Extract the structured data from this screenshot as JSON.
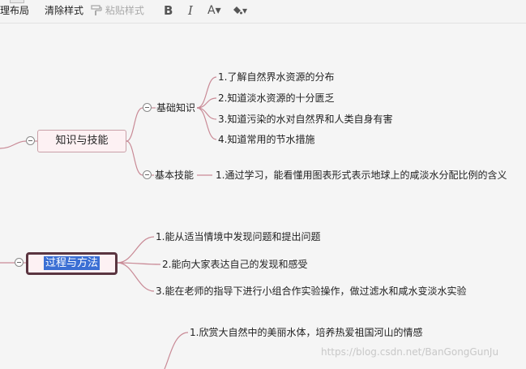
{
  "toolbar": {
    "layout_label": "理布局",
    "clear_style_label": "清除样式",
    "paste_style_label": "粘贴样式",
    "bold_label": "B",
    "italic_label": "I",
    "font_color_label": "A▾",
    "fill_color_label": "▾"
  },
  "mindmap": {
    "knowledge": {
      "title": "知识与技能",
      "basic_knowledge": {
        "label": "基础知识",
        "items": [
          "1.了解自然界水资源的分布",
          "2.知道淡水资源的十分匮乏",
          "3.知道污染的水对自然界和人类自身有害",
          "4.知道常用的节水措施"
        ]
      },
      "basic_skills": {
        "label": "基本技能",
        "items": [
          "1.通过学习，能看懂用图表形式表示地球上的咸淡水分配比例的含义"
        ]
      }
    },
    "process": {
      "title": "过程与方法",
      "items": [
        "1.能从适当情境中发现问题和提出问题",
        "2.能向大家表达自己的发现和感受",
        "3.能在老师的指导下进行小组合作实验操作，做过滤水和咸水变淡水实验"
      ]
    },
    "attitude": {
      "items": [
        "1.欣赏大自然中的美丽水体，培养热爱祖国河山的情感"
      ]
    }
  },
  "watermark": "https://blog.csdn.net/BanGongGunJu",
  "colors": {
    "link": "#c98a96",
    "node_border": "#c9a0a8",
    "node_fill": "#fdf1f3",
    "selection": "#3b6fd4"
  }
}
